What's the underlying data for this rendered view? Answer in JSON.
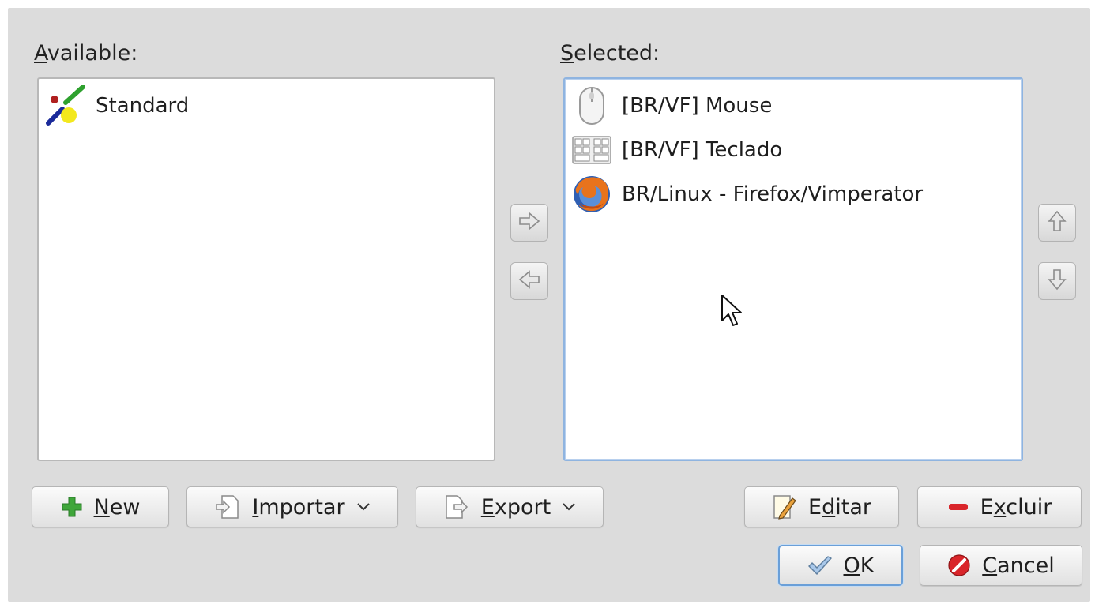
{
  "available": {
    "label_first": "A",
    "label_rest": "vailable:",
    "items": [
      {
        "label": "Standard",
        "icon": "standard-scheme-icon"
      }
    ]
  },
  "selected": {
    "label_first": "S",
    "label_rest": "elected:",
    "items": [
      {
        "label": "[BR/VF] Mouse",
        "icon": "mouse-icon"
      },
      {
        "label": "[BR/VF] Teclado",
        "icon": "keyboard-icon"
      },
      {
        "label": "BR/Linux - Firefox/Vimperator",
        "icon": "firefox-icon"
      }
    ]
  },
  "buttons": {
    "new": {
      "pre": "",
      "ul": "N",
      "post": "ew",
      "icon": "plus-icon"
    },
    "importar": {
      "pre": "",
      "ul": "I",
      "post": "mportar",
      "icon": "import-icon"
    },
    "export": {
      "pre": "",
      "ul": "E",
      "post": "xport",
      "icon": "export-icon"
    },
    "editar": {
      "pre": "E",
      "ul": "d",
      "post": "itar",
      "icon": "edit-icon"
    },
    "excluir": {
      "pre": "E",
      "ul": "x",
      "post": "cluir",
      "icon": "remove-icon"
    },
    "ok": {
      "pre": "",
      "ul": "O",
      "post": "K",
      "icon": "check-icon"
    },
    "cancel": {
      "pre": "",
      "ul": "C",
      "post": "ancel",
      "icon": "cancel-icon"
    }
  },
  "colors": {
    "dialog_bg": "#dcdcdc",
    "focus_border": "#6a9fd8",
    "plus_green": "#3fa63a",
    "remove_red": "#d9252a"
  }
}
